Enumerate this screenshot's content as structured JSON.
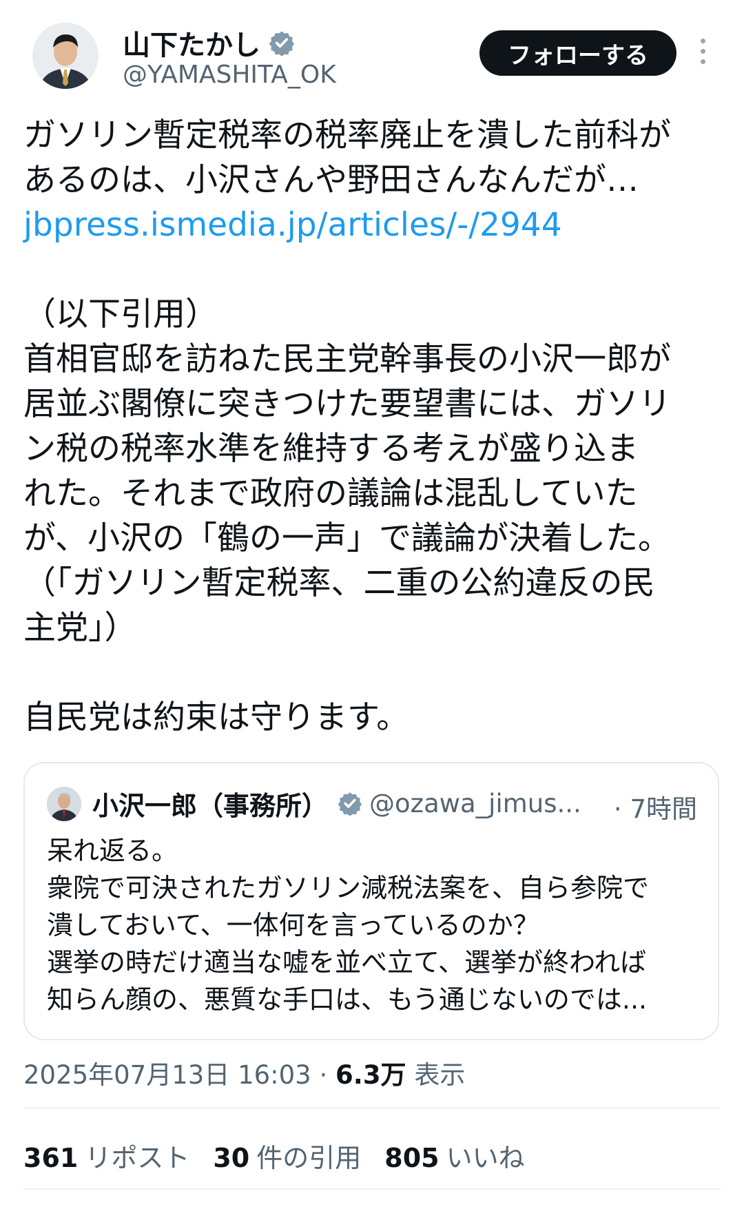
{
  "author": {
    "name": "山下たかし",
    "handle": "@YAMASHITA_OK",
    "verified_color": "#829aab"
  },
  "follow_button": "フォローする",
  "more_icon": "more-vertical-icon",
  "tweet": {
    "lines_1": [
      "ガソリン暫定税率の税率廃止を潰した前科が",
      "あるのは、小沢さんや野田さんなんだが…"
    ],
    "link": "jbpress.ismedia.jp/articles/-/2944",
    "lines_2": [
      "（以下引用）",
      "首相官邸を訪ねた民主党幹事長の小沢一郎が",
      "居並ぶ閣僚に突きつけた要望書には、ガソリ",
      "ン税の税率水準を維持する考えが盛り込ま",
      "れた。それまで政府の議論は混乱していた",
      "が、小沢の「鶴の一声」で議論が決着した。",
      "（「ガソリン暫定税率、二重の公約違反の民",
      "主党」）"
    ],
    "lines_3": [
      "自民党は約束は守ります。"
    ]
  },
  "quote": {
    "name": "小沢一郎（事務所）",
    "handle": "@ozawa_jimus...",
    "time": "· 7時間",
    "lines": [
      "呆れ返る。",
      "衆院で可決されたガソリン減税法案を、自ら参院で",
      "潰しておいて、一体何を言っているのか？",
      "選挙の時だけ適当な嘘を並べ立て、選挙が終われば",
      "知らん顔の、悪質な手口は、もう通じないのでは..."
    ]
  },
  "meta": {
    "timestamp": "2025年07月13日 16:03",
    "separator": " · ",
    "views": "6.3万",
    "views_label": " 表示"
  },
  "stats": {
    "reposts_count": "361",
    "reposts_label": "リポスト",
    "quotes_count": "30",
    "quotes_label": "件の引用",
    "likes_count": "805",
    "likes_label": "いいね"
  },
  "colors": {
    "link": "#1d9bf0",
    "text": "#0f1419",
    "muted": "#536471",
    "button_bg": "#0f1419"
  }
}
